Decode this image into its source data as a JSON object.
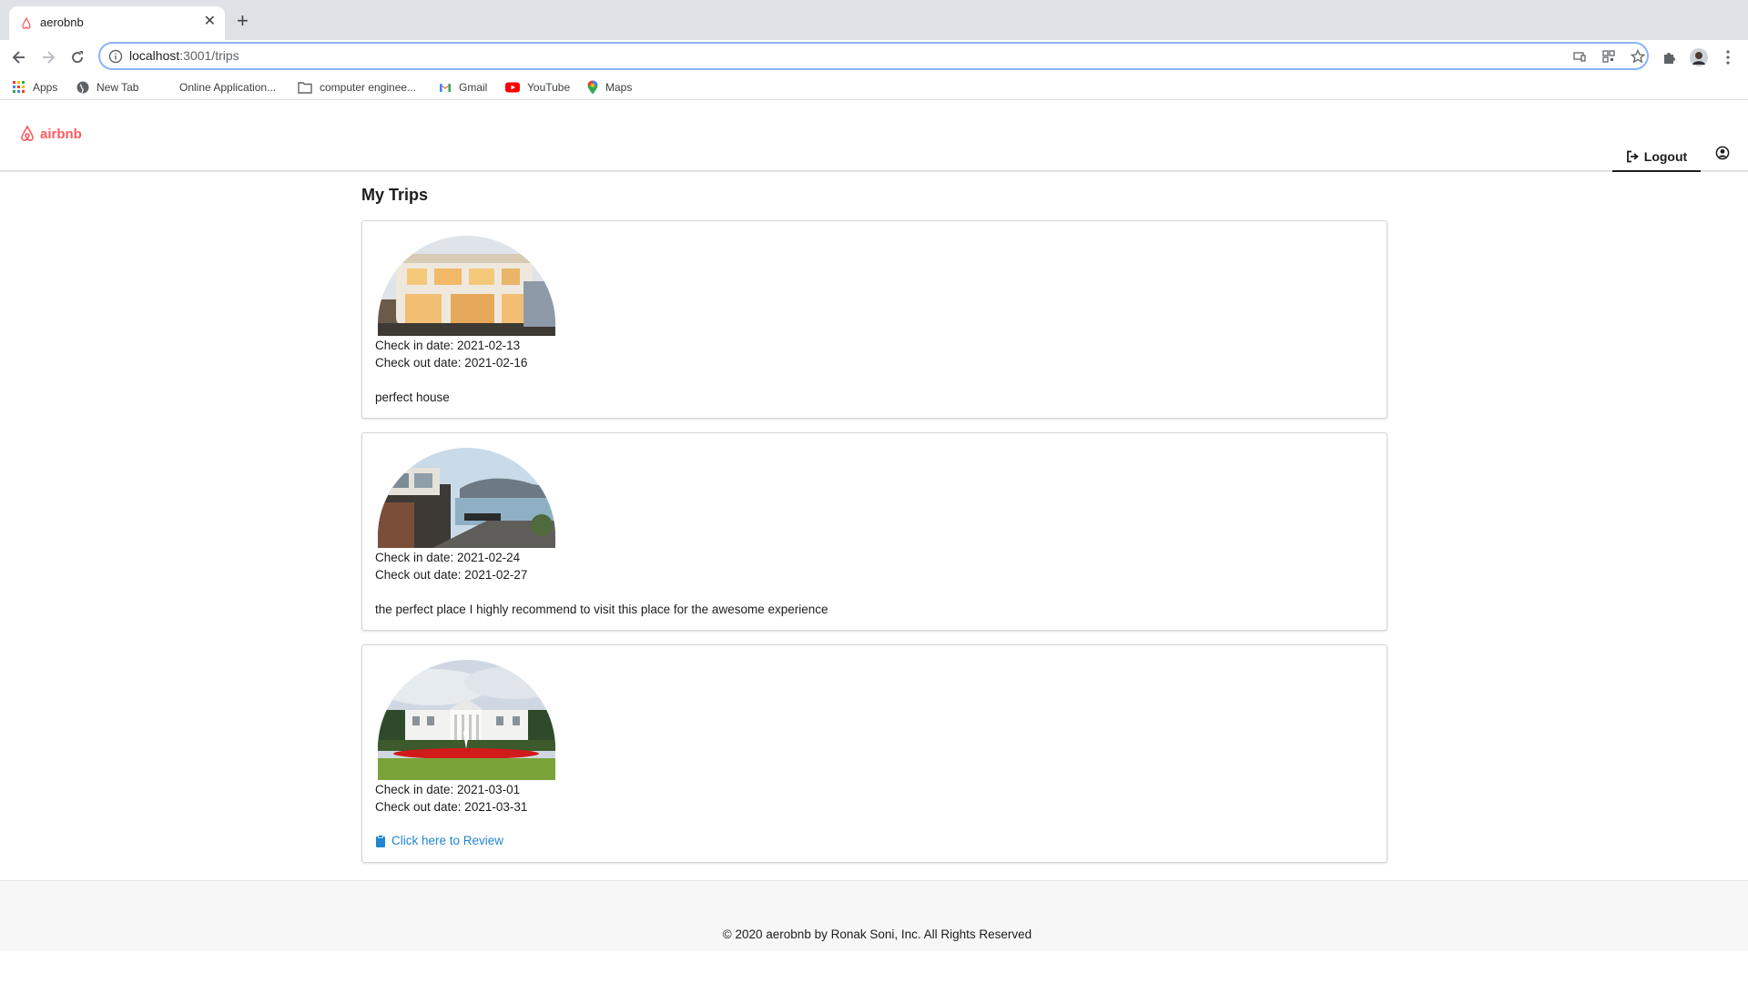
{
  "browser": {
    "tab_title": "aerobnb",
    "url_host": "localhost",
    "url_path": ":3001/trips",
    "bookmarks": [
      {
        "label": "Apps",
        "icon": "apps-grid-icon"
      },
      {
        "label": "New Tab",
        "icon": "globe-icon"
      },
      {
        "label": "Online Application...",
        "icon": "blank-page-icon"
      },
      {
        "label": "computer enginee...",
        "icon": "folder-icon"
      },
      {
        "label": "Gmail",
        "icon": "gmail-icon"
      },
      {
        "label": "YouTube",
        "icon": "youtube-icon"
      },
      {
        "label": "Maps",
        "icon": "maps-pin-icon"
      }
    ]
  },
  "header": {
    "logo_text": "airbnb",
    "logout_label": "Logout",
    "brand_color": "#ff5a5f"
  },
  "page": {
    "title": "My Trips"
  },
  "trips": [
    {
      "image": "luxury-villa-photo",
      "check_in": "Check in date: 2021-02-13",
      "check_out": "Check out date: 2021-02-16",
      "review": "perfect house"
    },
    {
      "image": "lakeside-house-photo",
      "check_in": "Check in date: 2021-02-24",
      "check_out": "Check out date: 2021-02-27",
      "review": "the perfect place I highly recommend to visit this place for the awesome experience"
    },
    {
      "image": "white-house-photo",
      "check_in": "Check in date: 2021-03-01",
      "check_out": "Check out date: 2021-03-31",
      "review_link": "Click here to Review"
    }
  ],
  "footer": {
    "text": "© 2020 aerobnb by Ronak Soni, Inc. All Rights Reserved"
  }
}
